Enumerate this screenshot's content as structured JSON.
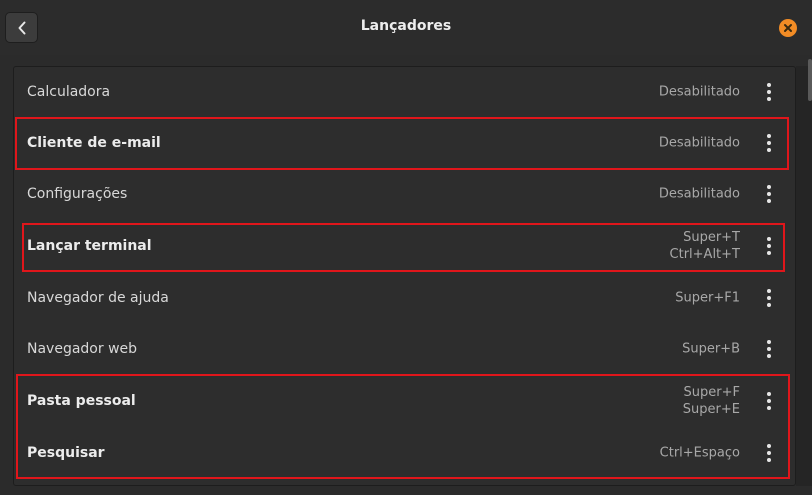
{
  "header": {
    "title": "Lançadores",
    "back_icon": "chevron-left-icon",
    "close_icon": "close-icon",
    "close_color": "#f28c25"
  },
  "launchers": [
    {
      "label": "Calculadora",
      "shortcut": [
        "Desabilitado"
      ],
      "bold": false
    },
    {
      "label": "Cliente de e-mail",
      "shortcut": [
        "Desabilitado"
      ],
      "bold": true
    },
    {
      "label": "Configurações",
      "shortcut": [
        "Desabilitado"
      ],
      "bold": false
    },
    {
      "label": "Lançar terminal",
      "shortcut": [
        "Super+T",
        "Ctrl+Alt+T"
      ],
      "bold": true
    },
    {
      "label": "Navegador de ajuda",
      "shortcut": [
        "Super+F1"
      ],
      "bold": false
    },
    {
      "label": "Navegador web",
      "shortcut": [
        "Super+B"
      ],
      "bold": false
    },
    {
      "label": "Pasta pessoal",
      "shortcut": [
        "Super+F",
        "Super+E"
      ],
      "bold": true
    },
    {
      "label": "Pesquisar",
      "shortcut": [
        "Ctrl+Espaço"
      ],
      "bold": true
    }
  ],
  "highlight_color": "#e0161b"
}
